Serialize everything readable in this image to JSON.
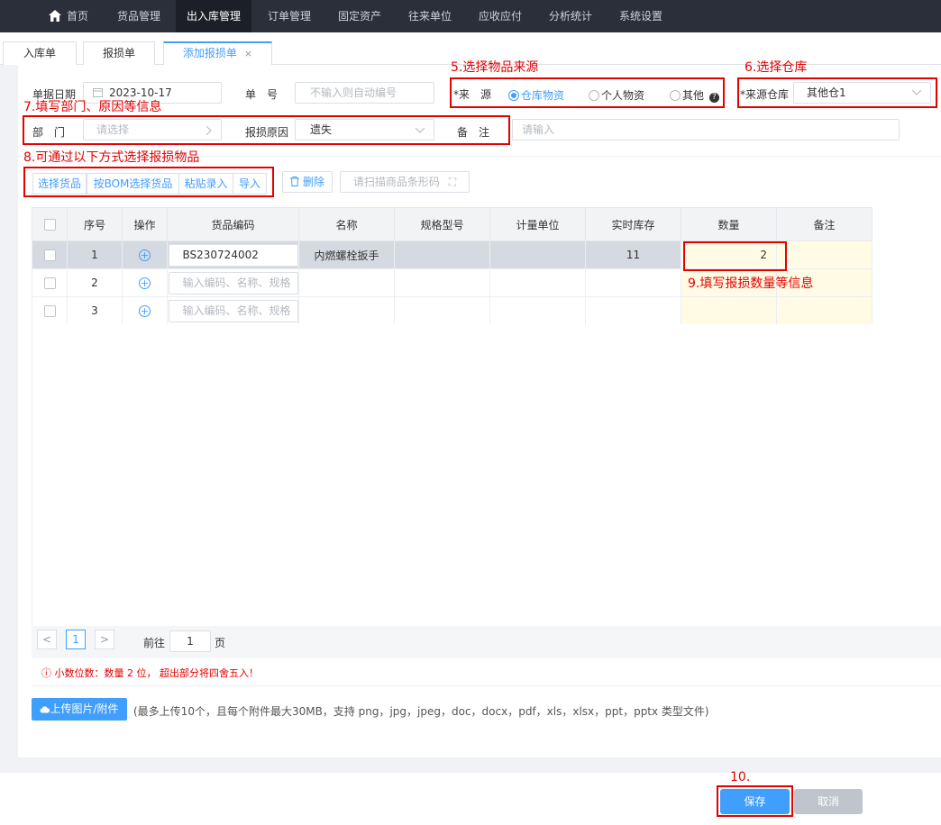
{
  "nav": {
    "items": [
      "首页",
      "货品管理",
      "出入库管理",
      "订单管理",
      "固定资产",
      "往来单位",
      "应收应付",
      "分析统计",
      "系统设置"
    ],
    "active_index": 2
  },
  "tabs": {
    "items": [
      "入库单",
      "报损单",
      "添加报损单"
    ],
    "active_index": 2,
    "close_glyph": "×"
  },
  "form": {
    "date_label": "单据日期",
    "date_value": "2023-10-17",
    "number_label": "单　号",
    "number_placeholder": "不输入则自动编号",
    "source_label": "*来　源",
    "source_options": [
      "仓库物资",
      "个人物资",
      "其他"
    ],
    "source_selected": "仓库物资",
    "warehouse_label": "*来源仓库",
    "warehouse_value": "其他仓1",
    "dept_label": "部　门",
    "dept_placeholder": "请选择",
    "reason_label": "报损原因",
    "reason_value": "遗失",
    "remark_label": "备　注",
    "remark_placeholder": "请输入"
  },
  "toolbar": {
    "select_goods": "选择货品",
    "select_bom": "按BOM选择货品",
    "paste_entry": "粘贴录入",
    "import": "导入",
    "delete": "删除",
    "scan_placeholder": "请扫描商品条形码"
  },
  "table": {
    "headers": [
      "序号",
      "操作",
      "货品编码",
      "名称",
      "规格型号",
      "计量单位",
      "实时库存",
      "数量",
      "备注"
    ],
    "code_placeholder": "输入编码、名称、规格",
    "rows": [
      {
        "no": "1",
        "code": "BS230724002",
        "name": "内燃螺栓扳手",
        "spec": "",
        "unit": "",
        "stock": "11",
        "qty": "2",
        "remark": ""
      },
      {
        "no": "2",
        "code": "",
        "name": "",
        "spec": "",
        "unit": "",
        "stock": "",
        "qty": "",
        "remark": ""
      },
      {
        "no": "3",
        "code": "",
        "name": "",
        "spec": "",
        "unit": "",
        "stock": "",
        "qty": "",
        "remark": ""
      }
    ]
  },
  "pager": {
    "current_page": "1",
    "goto_label": "前往",
    "goto_value": "1",
    "page_suffix": "页",
    "prev_glyph": "<",
    "next_glyph": ">"
  },
  "notice": "ⓘ 小数位数：数量 2 位， 超出部分将四舍五入！",
  "upload": {
    "button_label": "上传图片/附件",
    "description": "(最多上传10个，且每个附件最大30MB，支持 png，jpg，jpeg，doc，docx，pdf，xls，xlsx，ppt，pptx 类型文件)"
  },
  "footer": {
    "save_label": "保存",
    "cancel_label": "取消"
  },
  "annotations": {
    "step5": "5.选择物品来源",
    "step6": "6.选择仓库",
    "step7": "7.填写部门、原因等信息",
    "step8": "8.可通过以下方式选择报损物品",
    "step9": "9.填写报损数量等信息",
    "step10": "10."
  },
  "colors": {
    "nav_bg": "#2b2f3a",
    "primary": "#409eff",
    "annotation_red": "#e60000",
    "cancel_bg": "#c0c4cc"
  }
}
